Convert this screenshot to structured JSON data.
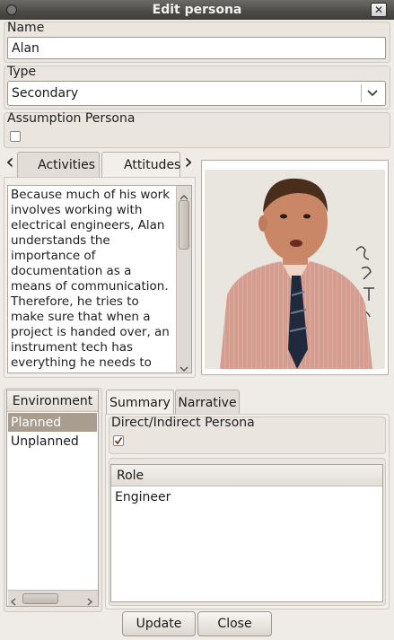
{
  "window": {
    "title": "Edit persona",
    "close_glyph": "✕"
  },
  "name_section": {
    "label": "Name",
    "value": "Alan"
  },
  "type_section": {
    "label": "Type",
    "value": "Secondary"
  },
  "assumption": {
    "label": "Assumption Persona",
    "checked": false
  },
  "tabs": {
    "prev_glyph": "‹",
    "next_glyph": "›",
    "items": [
      {
        "label": "Activities"
      },
      {
        "label": "Attitudes"
      }
    ]
  },
  "attitudes_text": "Because much of his work involves working with electrical engineers, Alan understands the importance of documentation as a means of communication. Therefore, he tries to make sure that when a project is handed over, an instrument tech has everything he needs to maintain and support the",
  "environment": {
    "header": "Environment",
    "items": [
      "Planned",
      "Unplanned"
    ],
    "selected_index": 0
  },
  "detail_tabs": {
    "summary": "Summary",
    "narrative": "Narrative"
  },
  "direct_indirect": {
    "label": "Direct/Indirect Persona",
    "checked": true
  },
  "role_table": {
    "header": "Role",
    "rows": [
      "Engineer"
    ]
  },
  "buttons": {
    "update": "Update",
    "close": "Close"
  }
}
